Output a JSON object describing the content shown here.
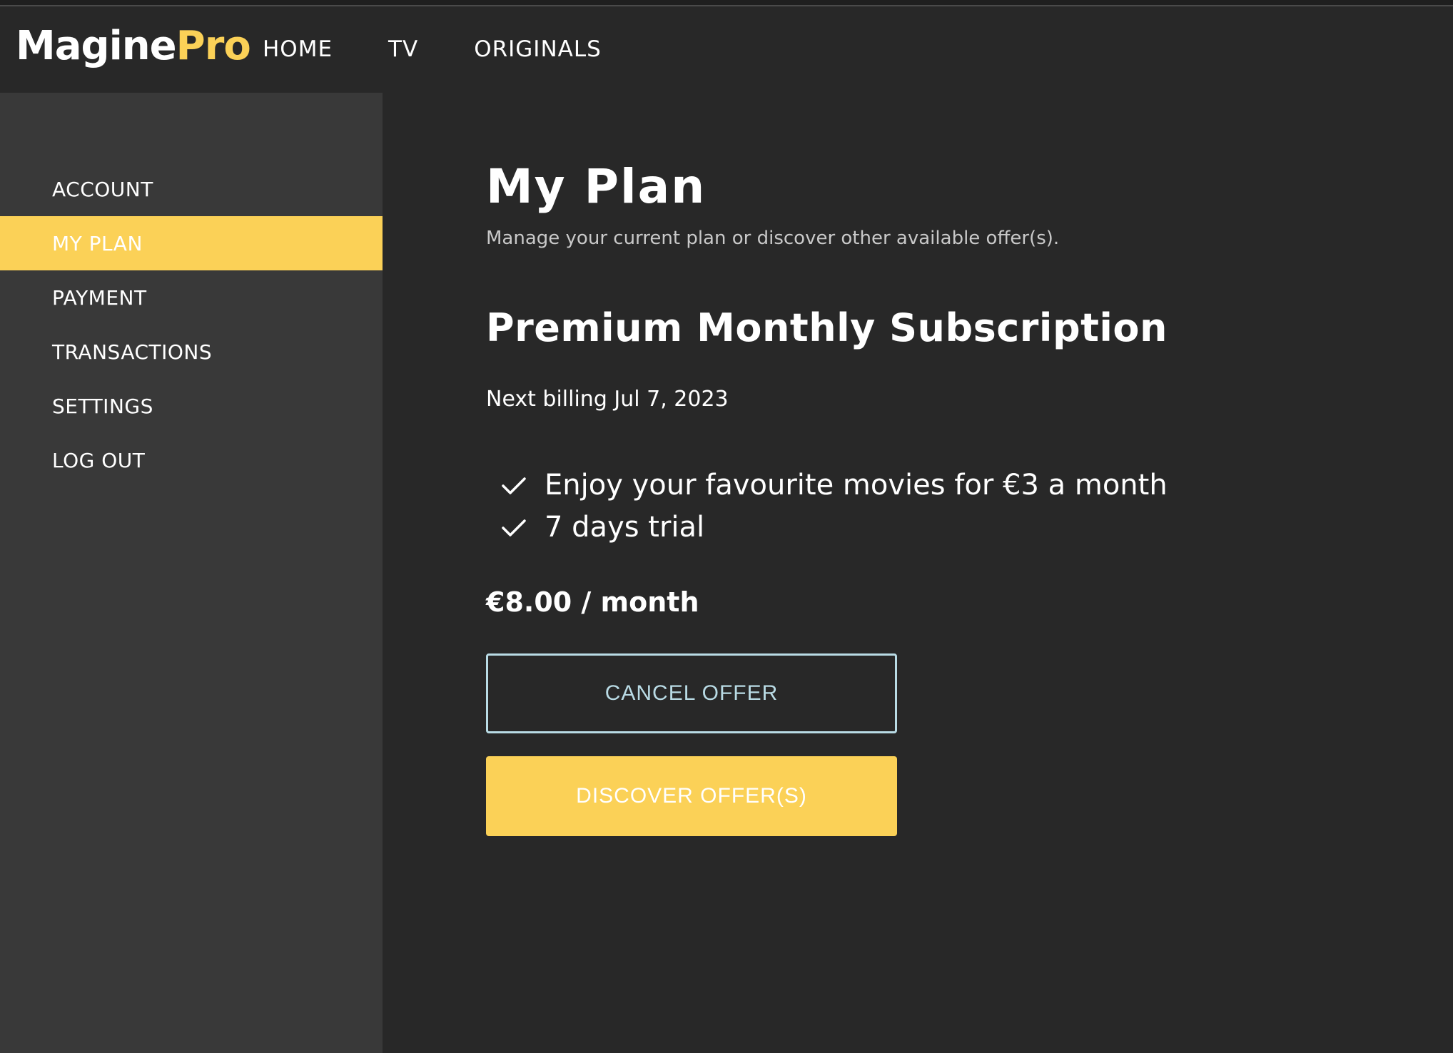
{
  "brand": {
    "logo_part1": "Magine",
    "logo_part2": "Pro",
    "accent_color": "#fbd157"
  },
  "nav": {
    "items": [
      "HOME",
      "TV",
      "ORIGINALS"
    ]
  },
  "sidebar": {
    "items": [
      {
        "label": "ACCOUNT",
        "active": false
      },
      {
        "label": "MY PLAN",
        "active": true
      },
      {
        "label": "PAYMENT",
        "active": false
      },
      {
        "label": "TRANSACTIONS",
        "active": false
      },
      {
        "label": "SETTINGS",
        "active": false
      },
      {
        "label": "LOG OUT",
        "active": false
      }
    ]
  },
  "main": {
    "title": "My Plan",
    "subtitle": "Manage your current plan or discover other available offer(s).",
    "plan": {
      "name": "Premium Monthly Subscription",
      "next_billing": "Next billing Jul 7, 2023",
      "features": [
        "Enjoy your favourite movies for €3 a month",
        "7 days trial"
      ],
      "feature_icon": "check-icon",
      "price": "€8.00 / month"
    },
    "buttons": {
      "cancel": "CANCEL OFFER",
      "discover": "DISCOVER OFFER(S)"
    }
  }
}
